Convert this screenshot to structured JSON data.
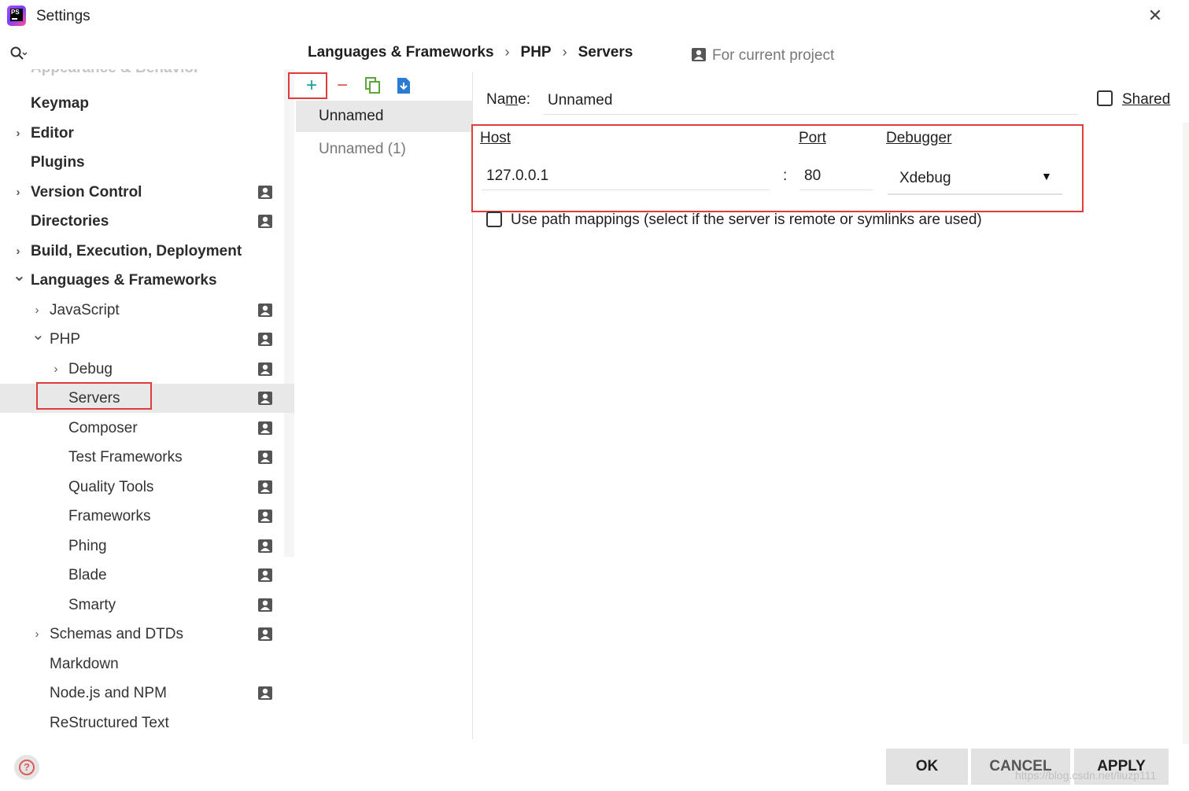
{
  "window": {
    "title": "Settings",
    "close_glyph": "✕"
  },
  "search": {
    "placeholder": "",
    "icon": "search-icon"
  },
  "sidebar": {
    "partial_item": "Appearance & Behavior",
    "items": [
      {
        "label": "Keymap",
        "weight": "bold",
        "indent": 0,
        "arrow": "",
        "project": false
      },
      {
        "label": "Editor",
        "weight": "bold",
        "indent": 0,
        "arrow": "›",
        "project": false
      },
      {
        "label": "Plugins",
        "weight": "bold",
        "indent": 0,
        "arrow": "",
        "project": false
      },
      {
        "label": "Version Control",
        "weight": "bold",
        "indent": 0,
        "arrow": "›",
        "project": true
      },
      {
        "label": "Directories",
        "weight": "bold",
        "indent": 0,
        "arrow": "",
        "project": true
      },
      {
        "label": "Build, Execution, Deployment",
        "weight": "bold",
        "indent": 0,
        "arrow": "›",
        "project": false
      },
      {
        "label": "Languages & Frameworks",
        "weight": "bold",
        "indent": 0,
        "arrow": "⌄",
        "project": false
      },
      {
        "label": "JavaScript",
        "weight": "normal",
        "indent": 1,
        "arrow": "›",
        "project": true
      },
      {
        "label": "PHP",
        "weight": "normal",
        "indent": 1,
        "arrow": "⌄",
        "project": true
      },
      {
        "label": "Debug",
        "weight": "normal",
        "indent": 2,
        "arrow": "›",
        "project": true
      },
      {
        "label": "Servers",
        "weight": "normal",
        "indent": 2,
        "arrow": "",
        "project": true,
        "selected": true
      },
      {
        "label": "Composer",
        "weight": "normal",
        "indent": 2,
        "arrow": "",
        "project": true
      },
      {
        "label": "Test Frameworks",
        "weight": "normal",
        "indent": 2,
        "arrow": "",
        "project": true
      },
      {
        "label": "Quality Tools",
        "weight": "normal",
        "indent": 2,
        "arrow": "",
        "project": true
      },
      {
        "label": "Frameworks",
        "weight": "normal",
        "indent": 2,
        "arrow": "",
        "project": true
      },
      {
        "label": "Phing",
        "weight": "normal",
        "indent": 2,
        "arrow": "",
        "project": true
      },
      {
        "label": "Blade",
        "weight": "normal",
        "indent": 2,
        "arrow": "",
        "project": true
      },
      {
        "label": "Smarty",
        "weight": "normal",
        "indent": 2,
        "arrow": "",
        "project": true
      },
      {
        "label": "Schemas and DTDs",
        "weight": "normal",
        "indent": 1,
        "arrow": "›",
        "project": true
      },
      {
        "label": "Markdown",
        "weight": "normal",
        "indent": 1,
        "arrow": "",
        "project": false
      },
      {
        "label": "Node.js and NPM",
        "weight": "normal",
        "indent": 1,
        "arrow": "",
        "project": true
      },
      {
        "label": "ReStructured Text",
        "weight": "normal",
        "indent": 1,
        "arrow": "",
        "project": false
      }
    ]
  },
  "breadcrumb": {
    "items": [
      "Languages & Frameworks",
      "PHP",
      "Servers"
    ],
    "separator": "›"
  },
  "scope": {
    "label": "For current project",
    "icon": "project-icon"
  },
  "toolbar": {
    "add": "+",
    "remove": "−",
    "copy_icon": "copy-icon",
    "import_icon": "import-icon"
  },
  "servers": {
    "items": [
      "Unnamed",
      "Unnamed (1)"
    ]
  },
  "form": {
    "name_label_pre": "Na",
    "name_label_mn": "m",
    "name_label_post": "e:",
    "name_value": "Unnamed",
    "shared_label": "Shared",
    "host_label": "Host",
    "host_value": "127.0.0.1",
    "colon": ":",
    "port_label": "Port",
    "port_value": "80",
    "debugger_label": "Debugger",
    "debugger_value": "Xdebug",
    "debugger_caret": "▼",
    "path_mappings_label": "Use path mappings (select if the server is remote or symlinks are used)",
    "shared_checked": false,
    "path_mappings_checked": false
  },
  "buttons": {
    "ok": "OK",
    "cancel": "CANCEL",
    "apply": "APPLY",
    "help_glyph": "?"
  },
  "watermark": "https://blog.csdn.net/liuzp111",
  "colors": {
    "highlight_box": "#e03c3c",
    "add": "#1e9b9b",
    "remove": "#e05050",
    "copy": "#5aa83c",
    "import": "#2a7bd4"
  }
}
